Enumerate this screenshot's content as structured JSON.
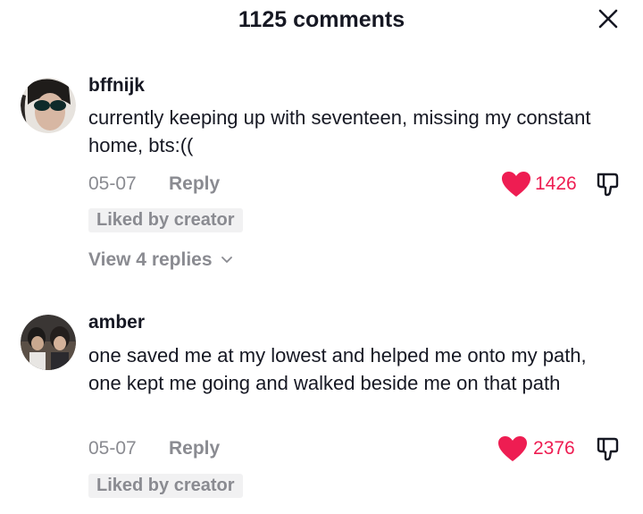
{
  "header": {
    "title": "1125 comments"
  },
  "comments": [
    {
      "username": "bffnijk",
      "text": "currently keeping up with seventeen, missing my constant home, bts:((",
      "date": "05-07",
      "reply_label": "Reply",
      "likes": "1426",
      "badge": "Liked by creator",
      "view_replies": "View 4 replies"
    },
    {
      "username": "amber",
      "text": "one saved me at my lowest and helped me onto my path, one kept me going and walked beside me on that path",
      "date": "05-07",
      "reply_label": "Reply",
      "likes": "2376",
      "badge": "Liked by creator"
    }
  ],
  "colors": {
    "like": "#ee1d52",
    "muted": "#8a8b91",
    "text": "#161823"
  },
  "icons": [
    "close-icon",
    "heart-icon",
    "dislike-icon",
    "chevron-down-icon"
  ]
}
